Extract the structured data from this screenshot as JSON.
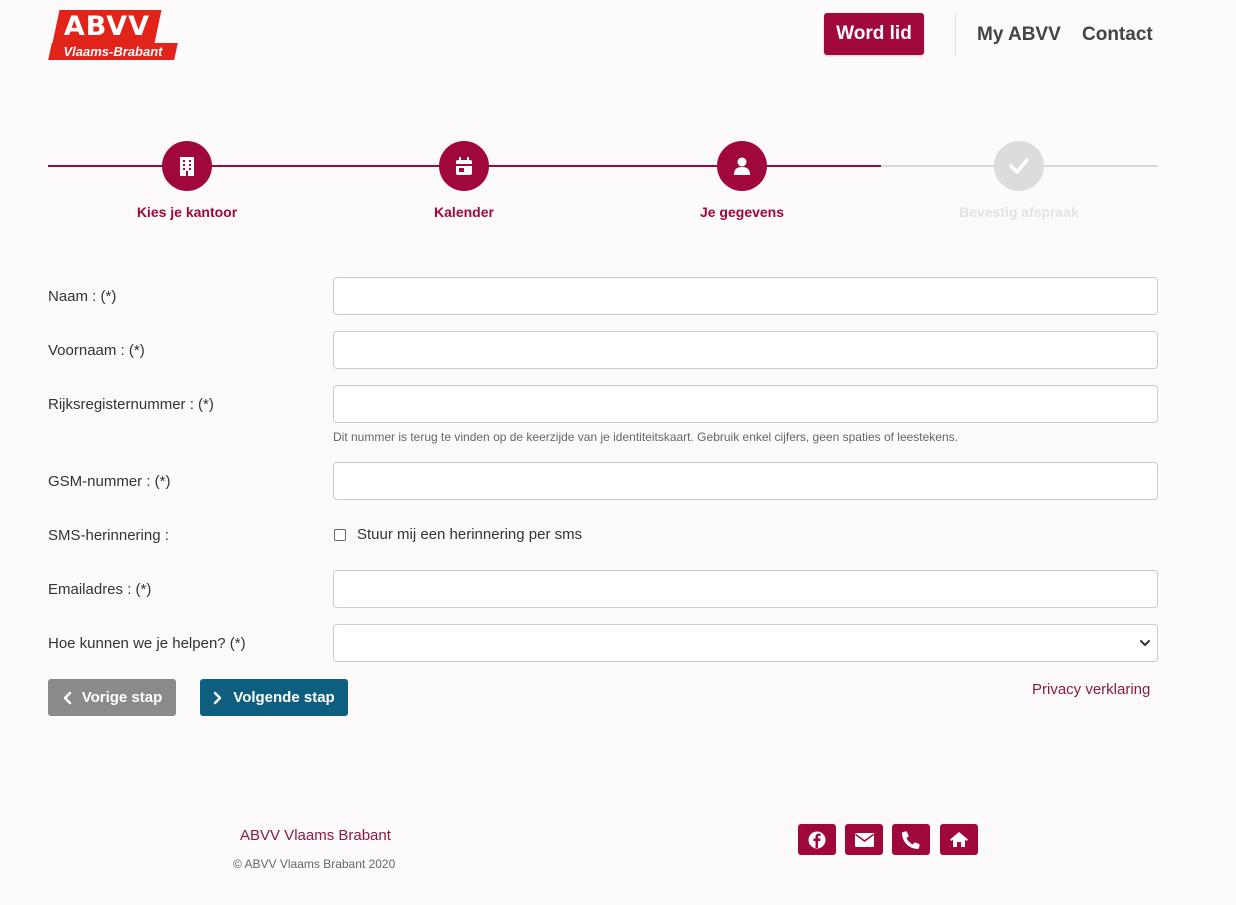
{
  "brand": {
    "logo_top": "ABVV",
    "logo_bottom": "Vlaams-Brabant",
    "primary_color": "#a0083d",
    "logo_color": "#e2231a"
  },
  "nav": {
    "join_label": "Word lid",
    "my_label": "My ABVV",
    "contact_label": "Contact"
  },
  "steps": [
    {
      "label": "Kies je kantoor",
      "icon": "building-icon",
      "state": "done"
    },
    {
      "label": "Kalender",
      "icon": "calendar-icon",
      "state": "done"
    },
    {
      "label": "Je gegevens",
      "icon": "user-icon",
      "state": "current"
    },
    {
      "label": "Bevestig afspraak",
      "icon": "check-icon",
      "state": "pending"
    }
  ],
  "form": {
    "naam_label": "Naam : (*)",
    "voornaam_label": "Voornaam : (*)",
    "rrn_label": "Rijksregisternummer : (*)",
    "rrn_help": "Dit nummer is terug te vinden op de keerzijde van je identiteitskaart. Gebruik enkel cijfers, geen spaties of leestekens.",
    "gsm_label": "GSM-nummer : (*)",
    "sms_label": "SMS-herinnering :",
    "sms_checkbox_label": "Stuur mij een herinnering per sms",
    "sms_checked": false,
    "email_label": "Emailadres : (*)",
    "help_label": "Hoe kunnen we je helpen? (*)",
    "naam_value": "",
    "voornaam_value": "",
    "rrn_value": "",
    "gsm_value": "",
    "email_value": "",
    "help_value": ""
  },
  "actions": {
    "prev_label": "Vorige stap",
    "next_label": "Volgende stap",
    "privacy_label": "Privacy verklaring",
    "prev_color": "#8a8a8a",
    "next_color": "#0e5f7f"
  },
  "footer": {
    "title": "ABVV Vlaams Brabant",
    "copyright": "© ABVV Vlaams Brabant 2020",
    "social_icons": [
      "facebook-icon",
      "mail-icon",
      "phone-icon",
      "home-icon"
    ]
  }
}
